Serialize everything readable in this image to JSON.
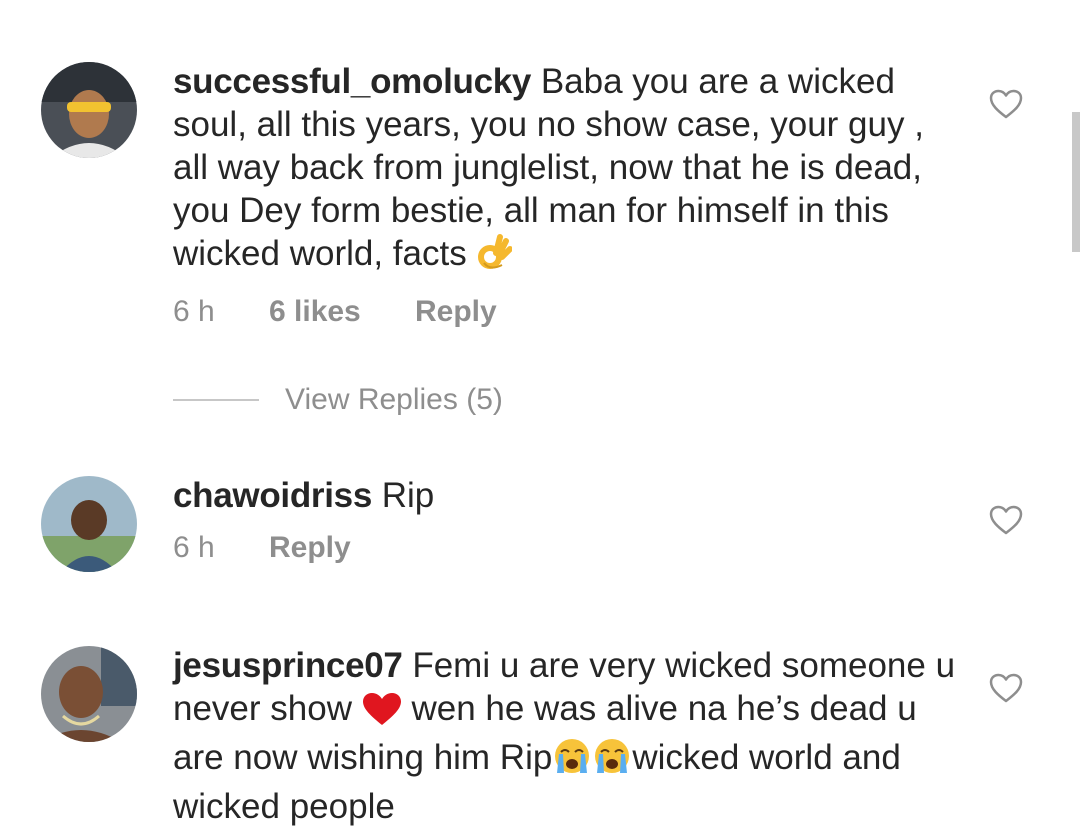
{
  "comments": [
    {
      "username": "successful_omolucky",
      "text": "Baba you are a wicked soul, all this years, you no show case, your guy , all way back from junglelist, now that he is dead, you Dey form bestie, all man for himself in this wicked world, facts",
      "emoji": "ok-hand-emoji",
      "time": "6 h",
      "likes": "6 likes",
      "reply": "Reply"
    },
    {
      "username": "chawoidriss",
      "text": "Rip",
      "time": "6 h",
      "reply": "Reply"
    },
    {
      "username": "jesusprince07",
      "text_part1": "Femi u are very wicked someone u never show",
      "text_part2": "wen he was alive na he’s dead u are now wishing him Rip",
      "text_part3": "wicked world and wicked people"
    }
  ],
  "view_replies": "View Replies (5)",
  "colors": {
    "text": "#262626",
    "secondary": "#8e8e8e",
    "heart_outline": "#8e8e8e"
  }
}
